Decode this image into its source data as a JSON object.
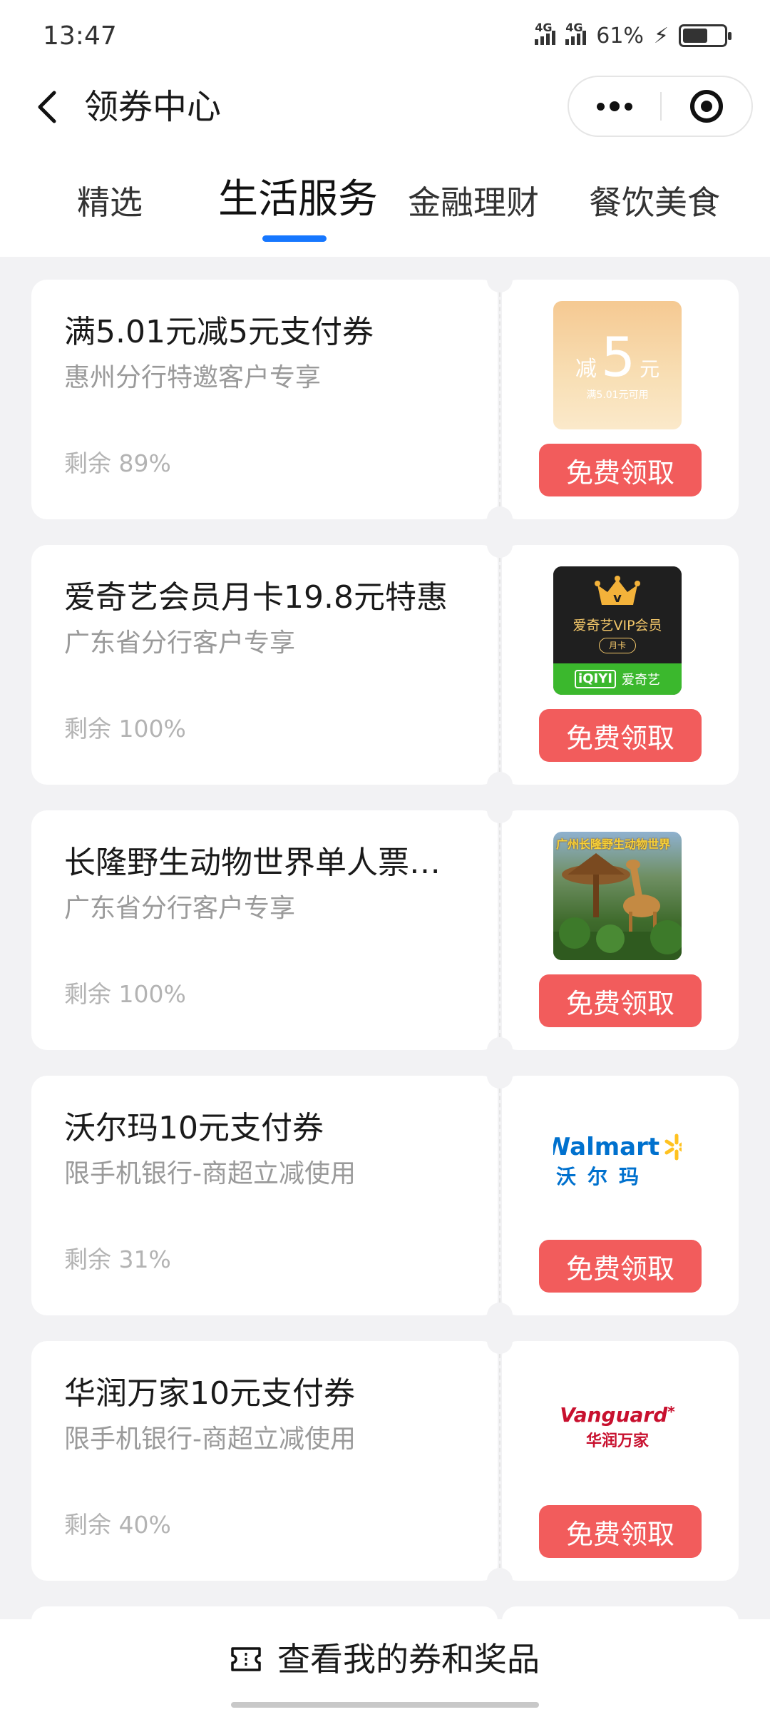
{
  "status_bar": {
    "time": "13:47",
    "network1": "4G",
    "network2": "4G",
    "battery_percent": "61%",
    "battery_level": 0.61
  },
  "nav": {
    "title": "领券中心"
  },
  "tabs": [
    {
      "label": "精选",
      "active": false
    },
    {
      "label": "生活服务",
      "active": true
    },
    {
      "label": "金融理财",
      "active": false
    },
    {
      "label": "餐饮美食",
      "active": false
    }
  ],
  "coupons": [
    {
      "title": "满5.01元减5元支付券",
      "subtitle": "惠州分行特邀客户专享",
      "remaining": "剩余 89%",
      "button": "免费领取",
      "thumb": {
        "prefix": "减",
        "amount": "5",
        "unit": "元",
        "condition": "满5.01元可用"
      }
    },
    {
      "title": "爱奇艺会员月卡19.8元特惠",
      "subtitle": "广东省分行客户专享",
      "remaining": "剩余 100%",
      "button": "免费领取",
      "thumb": {
        "vip": "爱奇艺VIP会员",
        "period": "月卡",
        "logo": "iQIYI",
        "brand": "爱奇艺"
      }
    },
    {
      "title": "长隆野生动物世界单人票…",
      "subtitle": "广东省分行客户专享",
      "remaining": "剩余 100%",
      "button": "免费领取",
      "thumb": {
        "caption": "广州长隆野生动物世界"
      }
    },
    {
      "title": "沃尔玛10元支付券",
      "subtitle": "限手机银行-商超立减使用",
      "remaining": "剩余 31%",
      "button": "免费领取",
      "thumb": {
        "en": "Walmart",
        "cn": "沃尔玛"
      }
    },
    {
      "title": "华润万家10元支付券",
      "subtitle": "限手机银行-商超立减使用",
      "remaining": "剩余 40%",
      "button": "免费领取",
      "thumb": {
        "en": "Vanguard",
        "cn": "华润万家"
      }
    }
  ],
  "bottom": {
    "label": "查看我的券和奖品"
  },
  "colors": {
    "accent": "#1677ff",
    "button": "#f25c5c",
    "background": "#f2f2f4"
  }
}
